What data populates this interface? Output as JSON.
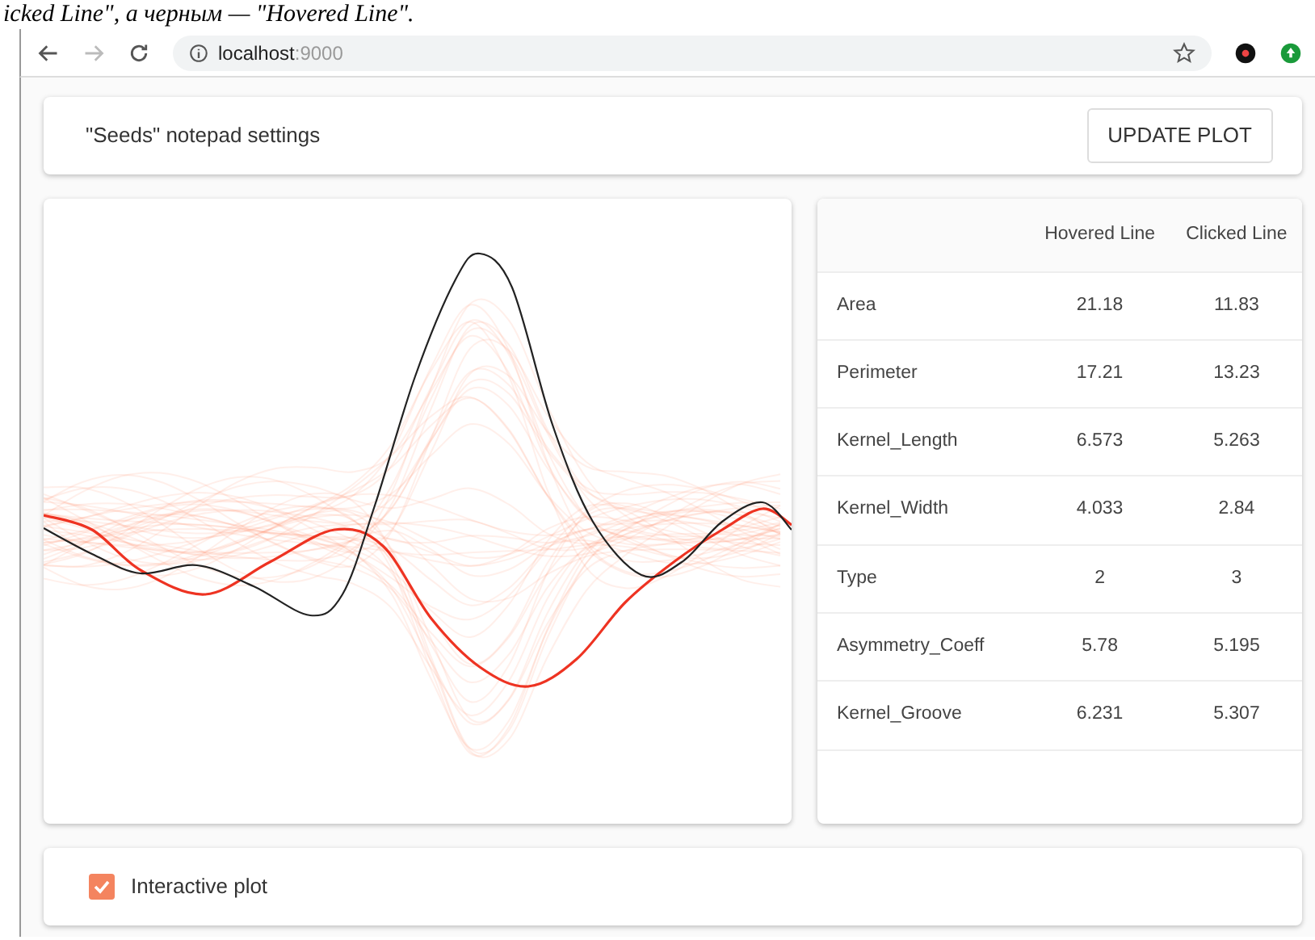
{
  "document_caption": "icked Line\", а черным — \"Hovered Line\".",
  "browser": {
    "address_host": "localhost",
    "address_port": ":9000"
  },
  "header": {
    "title": "\"Seeds\" notepad settings",
    "button": "UPDATE PLOT"
  },
  "table": {
    "columns": [
      "Hovered Line",
      "Clicked Line"
    ],
    "rows": [
      {
        "label": "Area",
        "hovered": "21.18",
        "clicked": "11.83"
      },
      {
        "label": "Perimeter",
        "hovered": "17.21",
        "clicked": "13.23"
      },
      {
        "label": "Kernel_Length",
        "hovered": "6.573",
        "clicked": "5.263"
      },
      {
        "label": "Kernel_Width",
        "hovered": "4.033",
        "clicked": "2.84"
      },
      {
        "label": "Type",
        "hovered": "2",
        "clicked": "3"
      },
      {
        "label": "Asymmetry_Coeff",
        "hovered": "5.78",
        "clicked": "5.195"
      },
      {
        "label": "Kernel_Groove",
        "hovered": "6.231",
        "clicked": "5.307"
      }
    ]
  },
  "footer": {
    "checkbox_label": "Interactive plot",
    "checked": true
  }
}
